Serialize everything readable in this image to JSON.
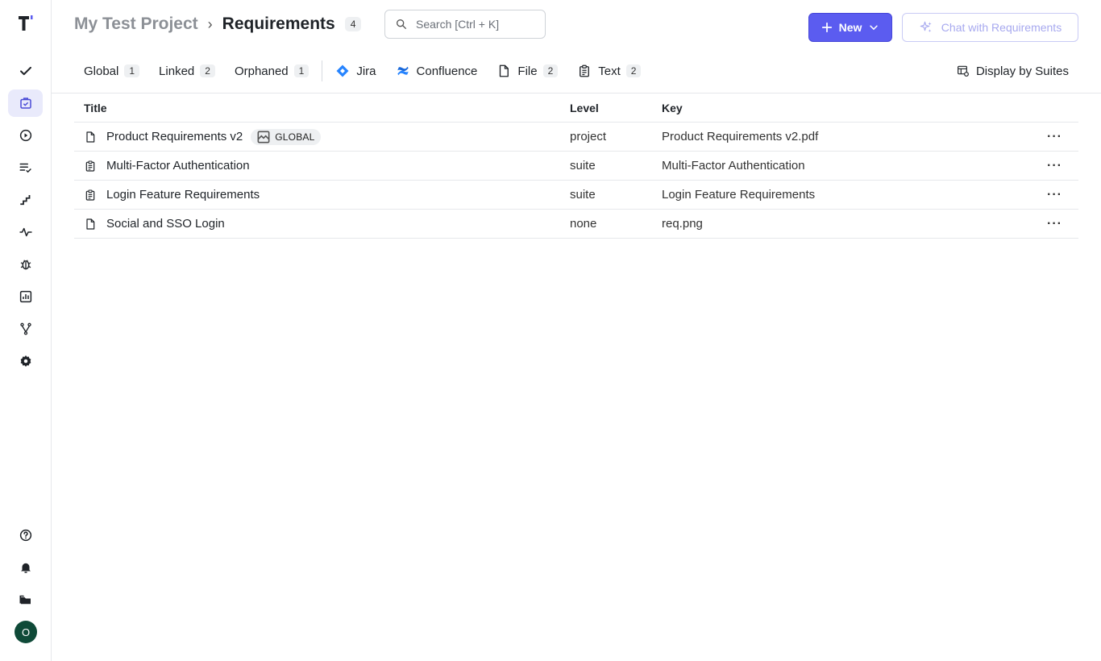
{
  "header": {
    "project_name": "My Test Project",
    "separator": "›",
    "page_title": "Requirements",
    "count": "4"
  },
  "search": {
    "placeholder": "Search [Ctrl + K]"
  },
  "actions": {
    "new_label": "New",
    "chat_label": "Chat with Requirements"
  },
  "tabs": [
    {
      "label": "Global",
      "count": "1"
    },
    {
      "label": "Linked",
      "count": "2"
    },
    {
      "label": "Orphaned",
      "count": "1"
    },
    {
      "label": "Jira"
    },
    {
      "label": "Confluence"
    },
    {
      "label": "File",
      "count": "2"
    },
    {
      "label": "Text",
      "count": "2"
    }
  ],
  "display_toggle": "Display by Suites",
  "table": {
    "columns": {
      "title": "Title",
      "level": "Level",
      "key": "Key"
    },
    "rows": [
      {
        "icon": "file-icon",
        "title": "Product Requirements v2",
        "badge": "GLOBAL",
        "level": "project",
        "key": "Product Requirements v2.pdf"
      },
      {
        "icon": "clipboard-icon",
        "title": "Multi-Factor Authentication",
        "level": "suite",
        "key": "Multi-Factor Authentication"
      },
      {
        "icon": "clipboard-icon",
        "title": "Login Feature Requirements",
        "level": "suite",
        "key": "Login Feature Requirements"
      },
      {
        "icon": "file-icon",
        "title": "Social and SSO Login",
        "level": "none",
        "key": "req.png"
      }
    ],
    "more_label": "···"
  },
  "user": {
    "avatar_initial": "O"
  },
  "colors": {
    "accent": "#5b5cf0",
    "avatar_bg": "#0f4a38",
    "active_nav_bg": "#e9eafb"
  }
}
